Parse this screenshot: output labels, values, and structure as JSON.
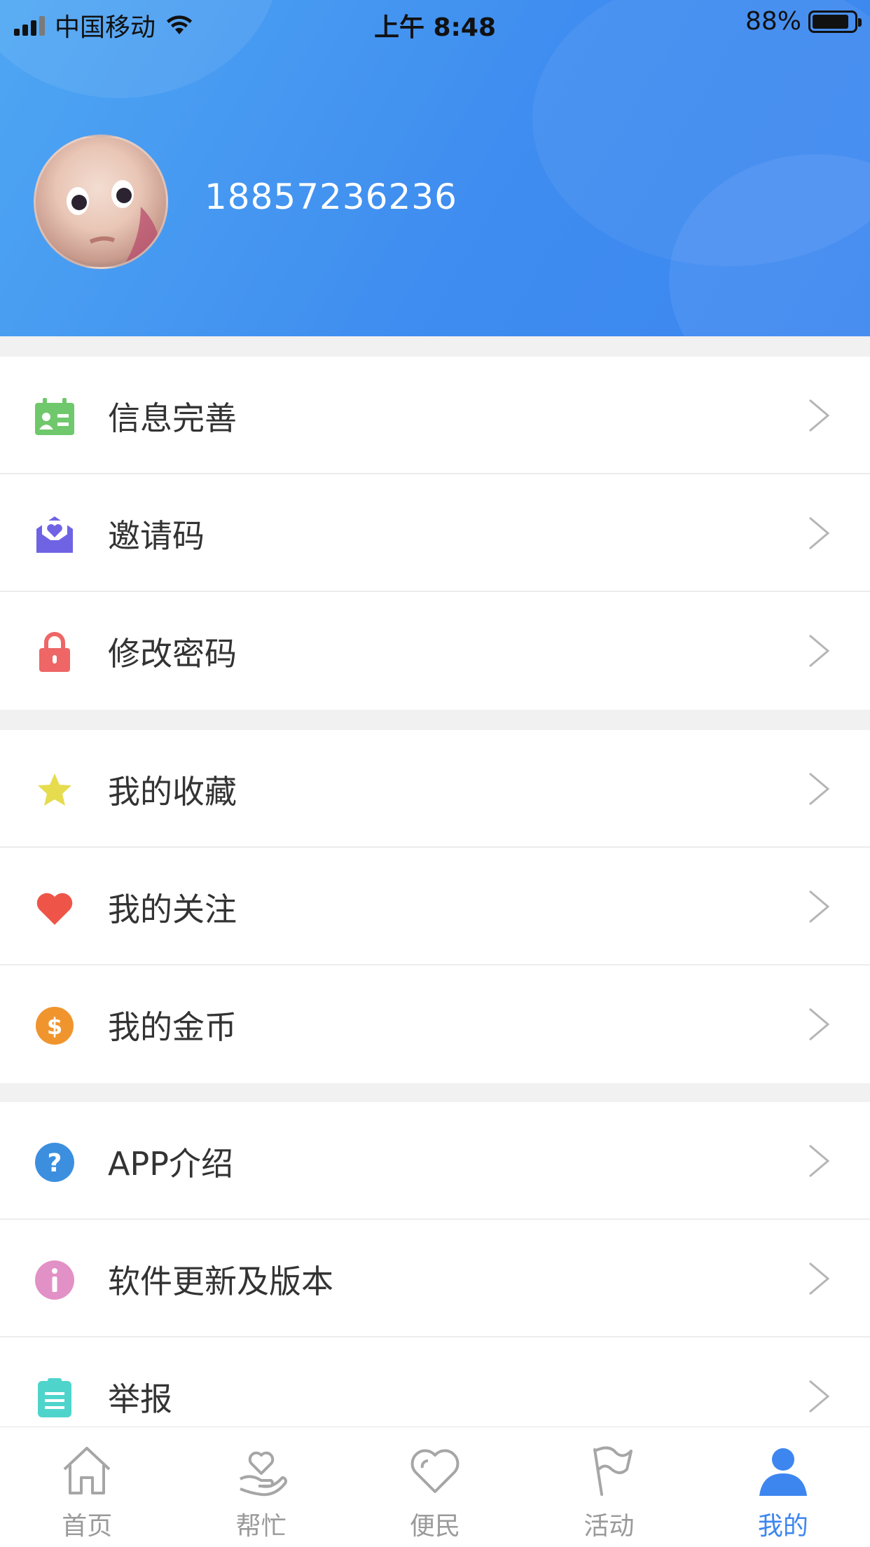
{
  "status_bar": {
    "carrier": "中国移动",
    "time": "上午 8:48",
    "battery": "88%",
    "battery_level": 0.88
  },
  "profile": {
    "username": "18857236236"
  },
  "menu_groups": [
    {
      "items": [
        {
          "label": "信息完善",
          "icon": "id-card-icon",
          "color": "#6fc86b"
        },
        {
          "label": "邀请码",
          "icon": "invite-envelope-icon",
          "color": "#6f63e4"
        },
        {
          "label": "修改密码",
          "icon": "lock-icon",
          "color": "#ee6666"
        }
      ]
    },
    {
      "items": [
        {
          "label": "我的收藏",
          "icon": "star-icon",
          "color": "#e6dc4e"
        },
        {
          "label": "我的关注",
          "icon": "heart-icon",
          "color": "#ee5548"
        },
        {
          "label": "我的金币",
          "icon": "coin-icon",
          "color": "#f0952e"
        }
      ]
    },
    {
      "items": [
        {
          "label": "APP介绍",
          "icon": "help-icon",
          "color": "#3c8fde"
        },
        {
          "label": "软件更新及版本",
          "icon": "info-icon",
          "color": "#e291c6"
        },
        {
          "label": "举报",
          "icon": "clipboard-icon",
          "color": "#4fd4cc"
        }
      ]
    }
  ],
  "tabbar": {
    "tabs": [
      {
        "label": "首页",
        "icon": "home-icon",
        "active": false
      },
      {
        "label": "帮忙",
        "icon": "helping-hand-icon",
        "active": false
      },
      {
        "label": "便民",
        "icon": "heart-outline-icon",
        "active": false
      },
      {
        "label": "活动",
        "icon": "flag-icon",
        "active": false
      },
      {
        "label": "我的",
        "icon": "user-icon",
        "active": true
      }
    ],
    "active_color": "#3d86f0",
    "inactive_color": "#9a9a9a"
  }
}
